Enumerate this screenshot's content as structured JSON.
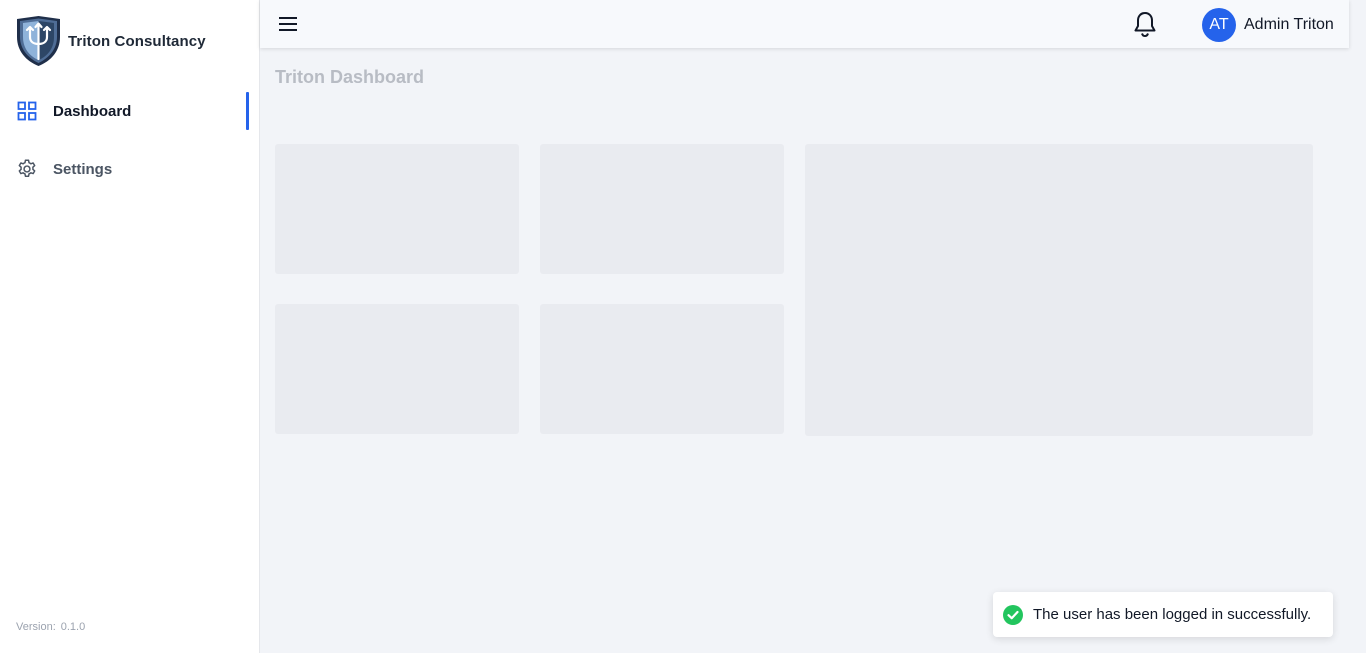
{
  "brand": {
    "name": "Triton Consultancy",
    "logo": "shield-trident-logo"
  },
  "sidebar": {
    "items": [
      {
        "label": "Dashboard",
        "icon": "grid-icon",
        "active": true
      },
      {
        "label": "Settings",
        "icon": "gear-icon",
        "active": false
      }
    ],
    "version_label": "Version:",
    "version_value": "0.1.0"
  },
  "topbar": {
    "menu_icon": "hamburger-icon",
    "bell_icon": "bell-icon",
    "user": {
      "initials": "AT",
      "name": "Admin Triton"
    }
  },
  "main": {
    "title": "Triton Dashboard"
  },
  "toast": {
    "message": "The user has been logged in successfully.",
    "icon": "check-circle-icon"
  },
  "colors": {
    "accent": "#2563eb",
    "success": "#22c55e",
    "background": "#f2f4f8",
    "skeleton": "#e9ebf0"
  }
}
